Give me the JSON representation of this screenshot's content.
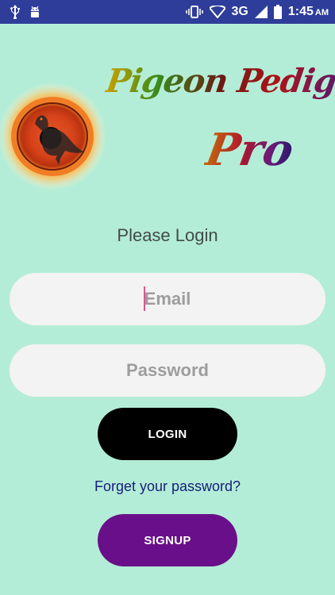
{
  "status_bar": {
    "network": "3G",
    "time": "1:45",
    "ampm": "AM",
    "icons": [
      "usb-icon",
      "android-icon",
      "vibrate-icon",
      "wifi-icon",
      "signal-icon",
      "battery-icon"
    ]
  },
  "app": {
    "title_line1": "Pigeon Pedigree",
    "title_line2": "Pro",
    "logo": "pigeon-eye-logo"
  },
  "login": {
    "heading": "Please Login",
    "email_placeholder": "Email",
    "password_placeholder": "Password",
    "login_label": "LOGIN",
    "forgot_label": "Forget your password?",
    "signup_label": "SIGNUP"
  },
  "colors": {
    "background": "#b4edd7",
    "status_bar": "#2e3d9a",
    "login_button": "#000000",
    "signup_button": "#6a0f8a",
    "link": "#18207a"
  }
}
